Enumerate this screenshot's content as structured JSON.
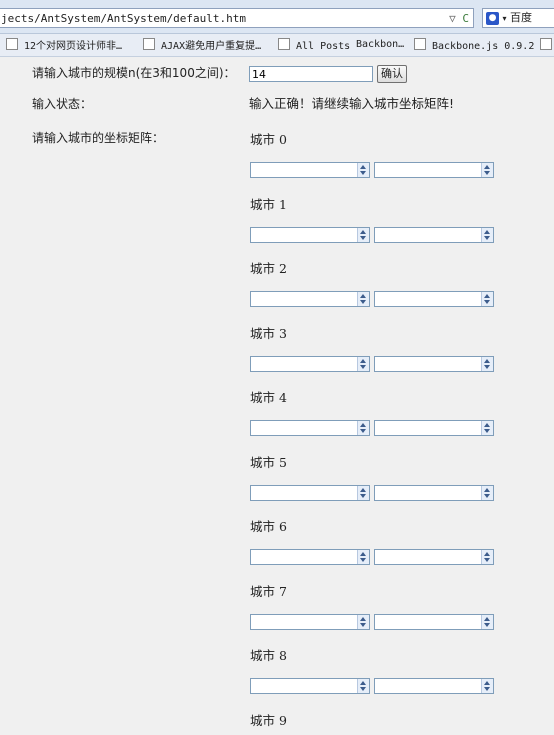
{
  "browser": {
    "url": "jects/AntSystem/AntSystem/default.htm",
    "search_engine": "百度",
    "bookmarks": [
      "12个对网页设计师非…",
      "AJAX避免用户重复提…",
      "All Posts",
      "Backbon…",
      "Backbone.js 0.9.2 …"
    ]
  },
  "form": {
    "size_label": "请输入城市的规模n(在3和100之间)：",
    "size_value": "14",
    "confirm_label": "确认",
    "status_label": "输入状态：",
    "status_text": "输入正确！请继续输入城市坐标矩阵!",
    "matrix_label": "请输入城市的坐标矩阵："
  },
  "cities": [
    {
      "label": "城市 0"
    },
    {
      "label": "城市 1"
    },
    {
      "label": "城市 2"
    },
    {
      "label": "城市 3"
    },
    {
      "label": "城市 4"
    },
    {
      "label": "城市 5"
    },
    {
      "label": "城市 6"
    },
    {
      "label": "城市 7"
    },
    {
      "label": "城市 8"
    },
    {
      "label": "城市 9"
    }
  ]
}
